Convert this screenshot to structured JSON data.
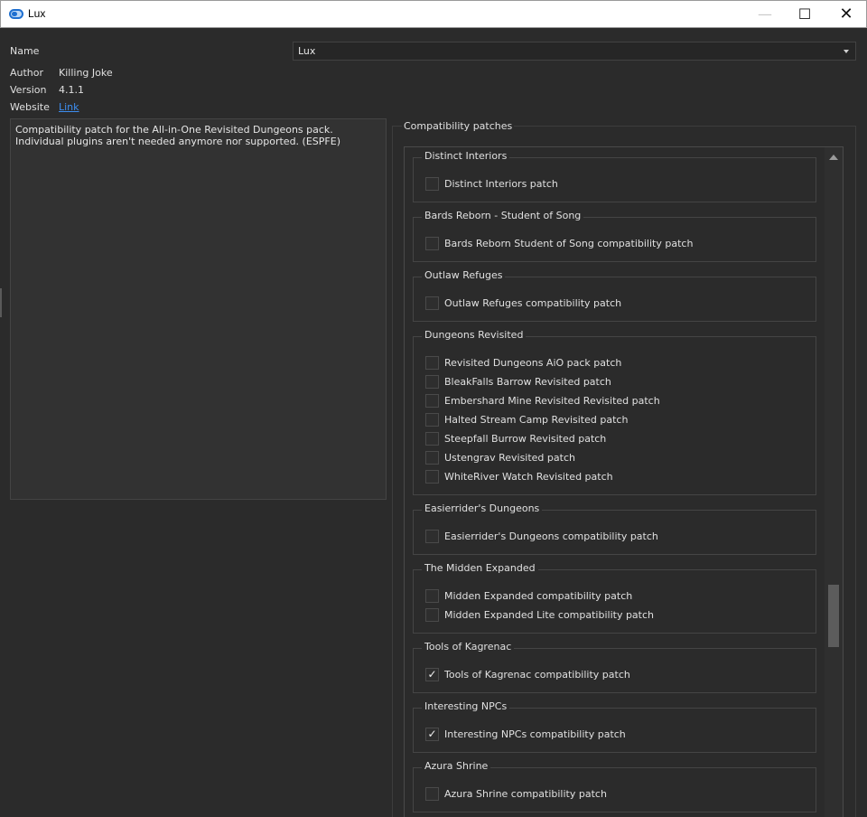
{
  "window": {
    "title": "Lux",
    "minimize": "—",
    "maximize": "☐",
    "close": "✕"
  },
  "fields": {
    "name_label": "Name",
    "name_value": "Lux",
    "author_label": "Author",
    "author_value": "Killing Joke",
    "version_label": "Version",
    "version_value": "4.1.1",
    "website_label": "Website",
    "website_link": "Link"
  },
  "description": "Compatibility patch for the All-in-One Revisited Dungeons pack. Individual plugins aren't needed anymore nor supported. (ESPFE)",
  "patches": {
    "title": "Compatibility patches",
    "groups": [
      {
        "title": "Distinct Interiors",
        "options": [
          {
            "label": "Distinct Interiors patch",
            "checked": false
          }
        ]
      },
      {
        "title": "Bards Reborn - Student of Song",
        "options": [
          {
            "label": "Bards Reborn Student of Song compatibility patch",
            "checked": false
          }
        ]
      },
      {
        "title": "Outlaw Refuges",
        "options": [
          {
            "label": "Outlaw Refuges compatibility patch",
            "checked": false
          }
        ]
      },
      {
        "title": "Dungeons Revisited",
        "options": [
          {
            "label": "Revisited Dungeons AiO pack patch",
            "checked": false
          },
          {
            "label": "BleakFalls Barrow Revisited patch",
            "checked": false
          },
          {
            "label": "Embershard Mine Revisited Revisited patch",
            "checked": false
          },
          {
            "label": "Halted Stream Camp Revisited patch",
            "checked": false
          },
          {
            "label": "Steepfall Burrow Revisited patch",
            "checked": false
          },
          {
            "label": "Ustengrav Revisited patch",
            "checked": false
          },
          {
            "label": "WhiteRiver Watch Revisited patch",
            "checked": false
          }
        ]
      },
      {
        "title": "Easierrider's Dungeons",
        "options": [
          {
            "label": "Easierrider's Dungeons compatibility patch",
            "checked": false
          }
        ]
      },
      {
        "title": "The Midden Expanded",
        "options": [
          {
            "label": "Midden Expanded compatibility patch",
            "checked": false
          },
          {
            "label": "Midden Expanded Lite compatibility patch",
            "checked": false
          }
        ]
      },
      {
        "title": "Tools of Kagrenac",
        "options": [
          {
            "label": "Tools of Kagrenac compatibility patch",
            "checked": true
          }
        ]
      },
      {
        "title": "Interesting NPCs",
        "options": [
          {
            "label": "Interesting NPCs compatibility patch",
            "checked": true
          }
        ]
      },
      {
        "title": "Azura Shrine",
        "options": [
          {
            "label": "Azura Shrine compatibility patch",
            "checked": false
          }
        ]
      }
    ]
  },
  "check_glyph": "✓"
}
